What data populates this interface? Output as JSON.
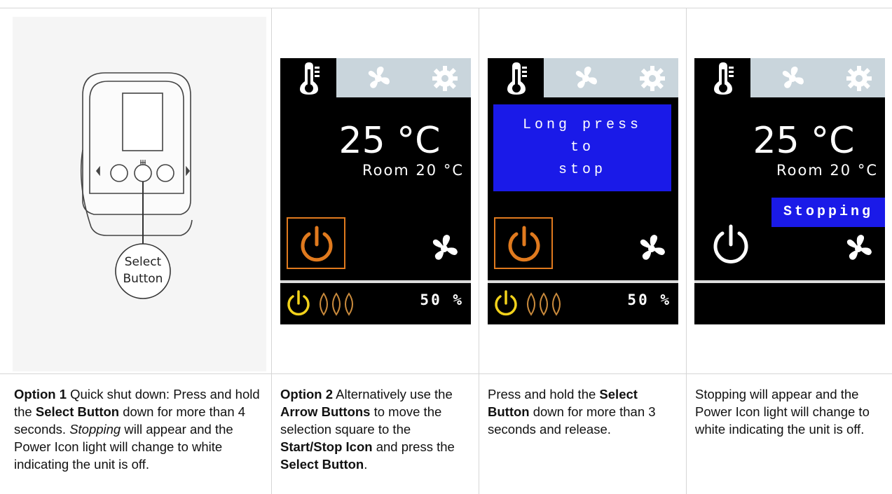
{
  "device": {
    "callout_line1": "Select",
    "callout_line2": "Button"
  },
  "screens": {
    "s1": {
      "temp": "25 °C",
      "room": "Room  20 °C",
      "percent": "50 %"
    },
    "s2": {
      "message_line1": "Long press",
      "message_line2": "to",
      "message_line3": "stop",
      "percent": "50 %"
    },
    "s3": {
      "temp": "25 °C",
      "room": "Room  20 °C",
      "status": "Stopping"
    }
  },
  "colors": {
    "tab_bar": "#c9d5dc",
    "message_blue": "#1a1ae8",
    "power_orange": "#e07a1e",
    "power_yellow": "#f2d21b",
    "flame_orange": "#c98a3c"
  },
  "captions": {
    "c1": {
      "p1": "Option 1",
      "p2": " Quick shut down: Press and hold the ",
      "p3": "Select Button",
      "p4": " down for more than 4 seconds. ",
      "p5": "Stopping",
      "p6": " will appear and the Power Icon light will change to white indicating the unit is off."
    },
    "c2": {
      "p1": "Option 2",
      "p2": " Alternatively use the ",
      "p3": "Arrow Buttons",
      "p4": " to move the selection square to the ",
      "p5": "Start/Stop Icon",
      "p6": " and press the ",
      "p7": "Select Button",
      "p8": "."
    },
    "c3": {
      "p1": "Press and hold the ",
      "p2": "Select Button",
      "p3": " down for more than 3 seconds and release."
    },
    "c4": {
      "p1": "Stopping will appear and the Power Icon light will change to white indicating the unit is off."
    }
  }
}
